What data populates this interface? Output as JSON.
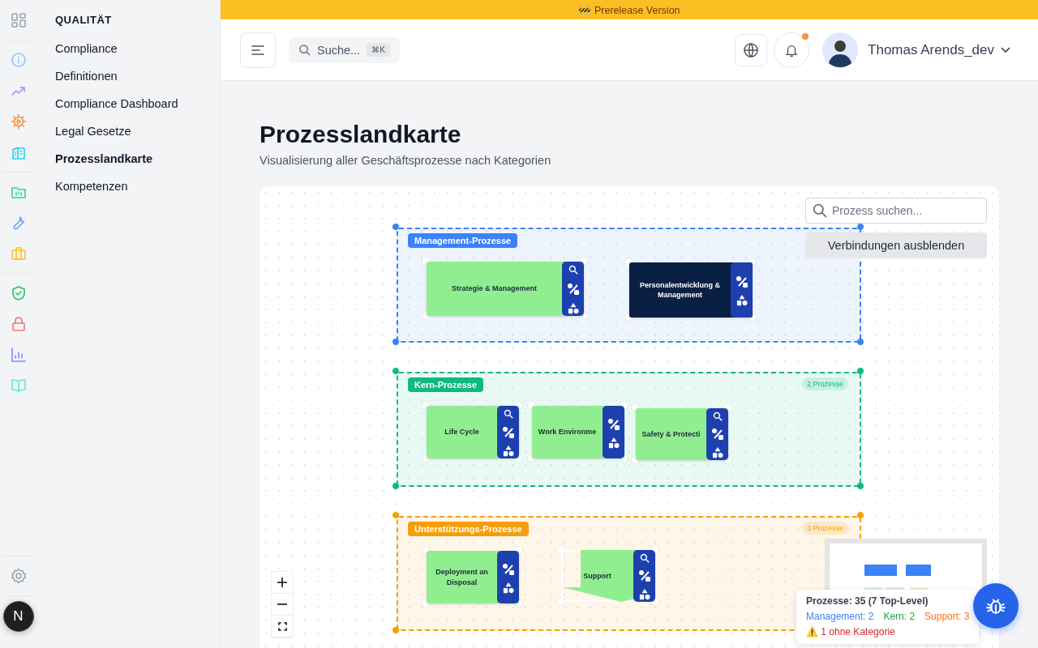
{
  "banner": {
    "text": "🚧 Prerelease Version"
  },
  "dev_badge": "N",
  "nav": {
    "heading": "QUALITÄT",
    "items": [
      {
        "label": "Compliance",
        "selected": false
      },
      {
        "label": "Definitionen",
        "selected": false
      },
      {
        "label": "Compliance Dashboard",
        "selected": false
      },
      {
        "label": "Legal Gesetze",
        "selected": false
      },
      {
        "label": "Prozesslandkarte",
        "selected": true
      },
      {
        "label": "Kompetenzen",
        "selected": false
      }
    ]
  },
  "header": {
    "search": {
      "placeholder": "Suche...",
      "shortcut": "⌘K"
    },
    "notifications": {
      "unread": true
    },
    "user": {
      "name": "Thomas Arends_dev"
    }
  },
  "page": {
    "title": "Prozesslandkarte",
    "subtitle": "Visualisierung aller Geschäftsprozesse nach Kategorien"
  },
  "map": {
    "search": {
      "placeholder": "Prozess suchen..."
    },
    "toggle_button": "Verbindungen ausblenden",
    "groups": [
      {
        "label": "Management-Prozesse",
        "color": "#3b82f6",
        "nodes": [
          {
            "label": "Strategie & Management",
            "kind": "rect",
            "color": "#90ee90",
            "search_icon": true
          },
          {
            "label": "Personalentwicklung & Management",
            "kind": "rect",
            "color": "#0a1f44",
            "search_icon": false
          }
        ]
      },
      {
        "label": "Kern-Prozesse",
        "color": "#10b981",
        "count": "2 Prozesse",
        "nodes": [
          {
            "label": "Life Cycle",
            "kind": "rect",
            "color": "#90ee90",
            "search_icon": true
          },
          {
            "label": "Work Environme",
            "kind": "rect",
            "color": "#90ee90",
            "search_icon": false
          },
          {
            "label": "Safety & Protecti",
            "kind": "rect",
            "color": "#90ee90",
            "search_icon": true
          }
        ]
      },
      {
        "label": "Unterstützungs-Prozesse",
        "color": "#f59e0b",
        "count": "3 Prozesse",
        "nodes": [
          {
            "label": "Deployment an Disposal",
            "kind": "rect",
            "color": "#90ee90",
            "search_icon": false
          },
          {
            "label": "Support",
            "kind": "arrow",
            "color": "#90ee90",
            "search_icon": true
          }
        ]
      }
    ],
    "stats": {
      "total": "Prozesse: 35 (7 Top-Level)",
      "categories": [
        {
          "text": "Management: 2",
          "color": "#3b82f6"
        },
        {
          "text": "Kern: 2",
          "color": "#16a34a"
        },
        {
          "text": "Support: 3",
          "color": "#f97316"
        }
      ],
      "warning": "⚠️ 1 ohne Kategorie"
    }
  }
}
